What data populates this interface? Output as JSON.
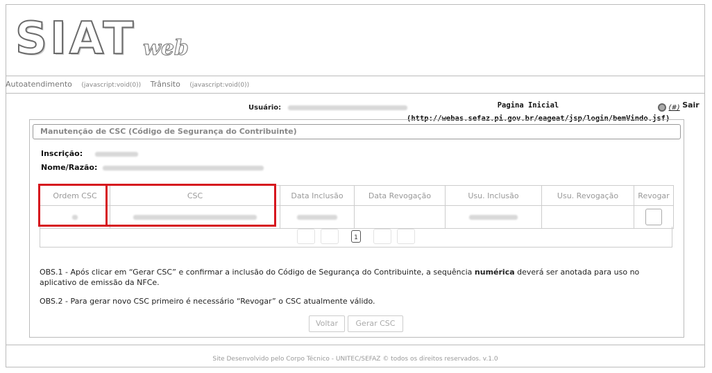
{
  "logo": {
    "main": "SIAT",
    "suffix": "web"
  },
  "nav": {
    "items": [
      {
        "label": "Autoatendimento",
        "href": "(javascript:void(0))"
      },
      {
        "label": "Trânsito",
        "href": "(javascript:void(0))"
      }
    ]
  },
  "user": {
    "label": "Usuário:"
  },
  "home": {
    "title": "Pagina Inicial",
    "url": "(http://webas.sefaz.pi.gov.br/eageat/jsp/login/bemVindo.jsf)"
  },
  "logout": {
    "hash": "(#)",
    "label": "Sair"
  },
  "panel": {
    "title": "Manutenção de CSC (Código de Segurança do Contribuinte)",
    "inscricao_label": "Inscrição:",
    "nome_label": "Nome/Razão:"
  },
  "table": {
    "headers": [
      "Ordem CSC",
      "CSC",
      "Data Inclusão",
      "Data Revogação",
      "Usu. Inclusão",
      "Usu. Revogação",
      "Revogar"
    ]
  },
  "pager": {
    "current": "1"
  },
  "obs": {
    "obs1_prefix": "OBS.1 - Após clicar em “Gerar CSC” e confirmar a inclusão do Código de Segurança do Contribuinte, a sequência ",
    "obs1_bold": "numérica",
    "obs1_suffix": " deverá ser anotada para uso no aplicativo de emissão da NFCe.",
    "obs2": "OBS.2 - Para gerar novo CSC primeiro é necessário “Revogar” o CSC atualmente válido."
  },
  "buttons": {
    "voltar": "Voltar",
    "gerar": "Gerar CSC"
  },
  "footer": {
    "text": "Site Desenvolvido pelo Corpo Técnico - UNITEC/SEFAZ © todos os direitos reservados. v.1.0"
  },
  "colors": {
    "highlight": "#d6161e"
  }
}
